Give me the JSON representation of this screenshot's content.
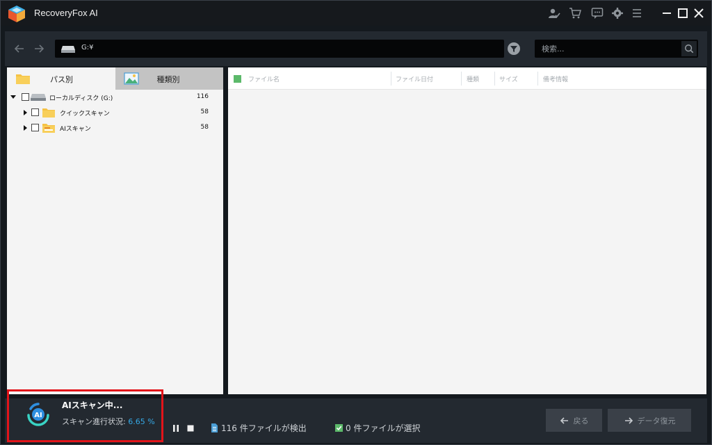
{
  "app": {
    "title": "RecoveryFox AI"
  },
  "toolbar": {
    "path": "G:¥",
    "search_placeholder": "検索..."
  },
  "tabs": [
    {
      "label": "パス別",
      "active": true
    },
    {
      "label": "種類別",
      "active": false
    }
  ],
  "tree": [
    {
      "label": "ローカルディスク (G:)",
      "count": "116",
      "icon": "drive-icon",
      "expanded": true
    },
    {
      "label": "クイックスキャン",
      "count": "58",
      "icon": "folder-icon",
      "expanded": false
    },
    {
      "label": "AIスキャン",
      "count": "58",
      "icon": "ai-folder-icon",
      "expanded": false
    }
  ],
  "table": {
    "columns": [
      "ファイル名",
      "ファイル日付",
      "種類",
      "サイズ",
      "備考情報"
    ]
  },
  "status": {
    "scan_title": "AIスキャン中...",
    "progress_label": "スキャン進行状況:",
    "progress_value": "6.65 %",
    "found_text": "116 件ファイルが検出",
    "selected_text": "0 件ファイルが選択",
    "back_label": "戻る",
    "recover_label": "データ復元"
  },
  "colors": {
    "accent_blue": "#35a9e6",
    "highlight_red": "#e2141a",
    "check_green": "#5cb96a",
    "folder_yellow": "#f5c244"
  }
}
